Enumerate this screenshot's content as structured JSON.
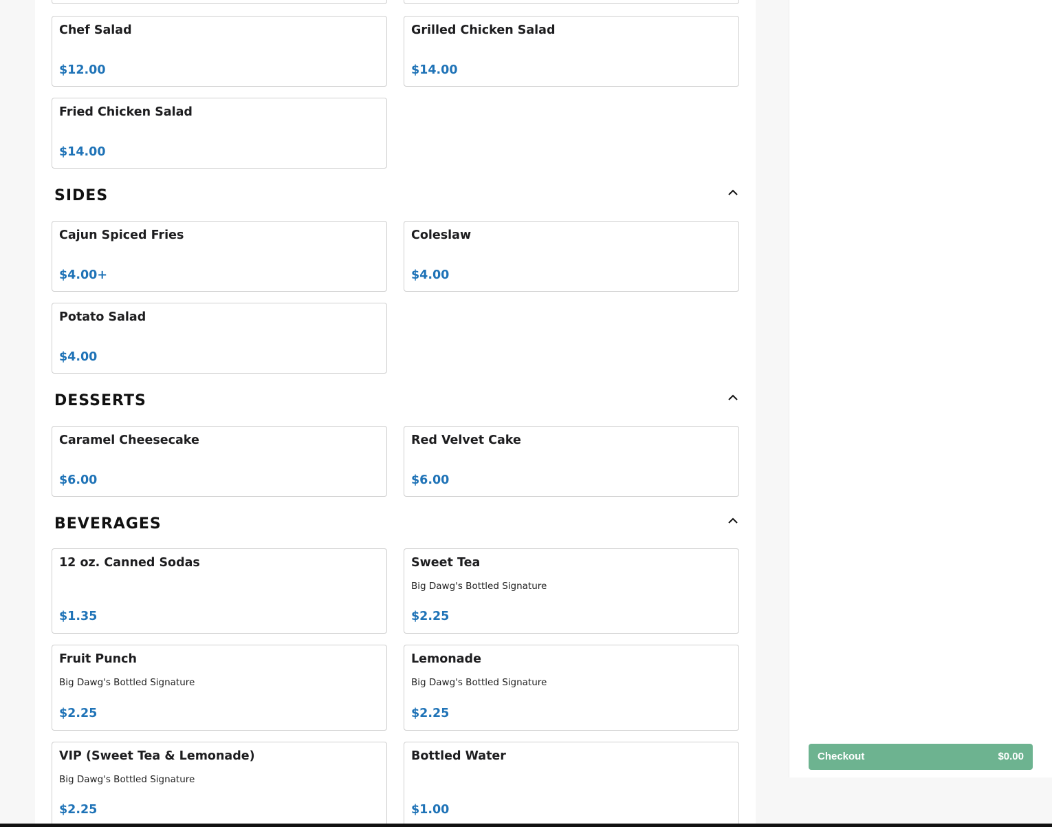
{
  "sections": {
    "sides": {
      "title": "SIDES"
    },
    "desserts": {
      "title": "DESSERTS"
    },
    "beverages": {
      "title": "BEVERAGES"
    }
  },
  "items": {
    "chef_salad": {
      "name": "Chef Salad",
      "price": "$12.00"
    },
    "grilled_chicken_salad": {
      "name": "Grilled Chicken Salad",
      "price": "$14.00"
    },
    "fried_chicken_salad": {
      "name": "Fried Chicken Salad",
      "price": "$14.00"
    },
    "cajun_spiced_fries": {
      "name": "Cajun Spiced Fries",
      "price": "$4.00+"
    },
    "coleslaw": {
      "name": "Coleslaw",
      "price": "$4.00"
    },
    "potato_salad": {
      "name": "Potato Salad",
      "price": "$4.00"
    },
    "caramel_cheesecake": {
      "name": "Caramel Cheesecake",
      "price": "$6.00"
    },
    "red_velvet_cake": {
      "name": "Red Velvet Cake",
      "price": "$6.00"
    },
    "canned_sodas": {
      "name": "12 oz. Canned Sodas",
      "price": "$1.35"
    },
    "sweet_tea": {
      "name": "Sweet Tea",
      "description": "Big Dawg's Bottled Signature",
      "price": "$2.25"
    },
    "fruit_punch": {
      "name": "Fruit Punch",
      "description": "Big Dawg's Bottled Signature",
      "price": "$2.25"
    },
    "lemonade": {
      "name": "Lemonade",
      "description": "Big Dawg's Bottled Signature",
      "price": "$2.25"
    },
    "vip": {
      "name": "VIP (Sweet Tea & Lemonade)",
      "description": "Big Dawg's Bottled Signature",
      "price": "$2.25"
    },
    "bottled_water": {
      "name": "Bottled Water",
      "price": "$1.00"
    }
  },
  "checkout": {
    "label": "Checkout",
    "total": "$0.00"
  },
  "icons": {
    "collapse": "chevron-up-icon"
  },
  "colors": {
    "price": "#1f73b7",
    "checkout": "#6db390"
  }
}
